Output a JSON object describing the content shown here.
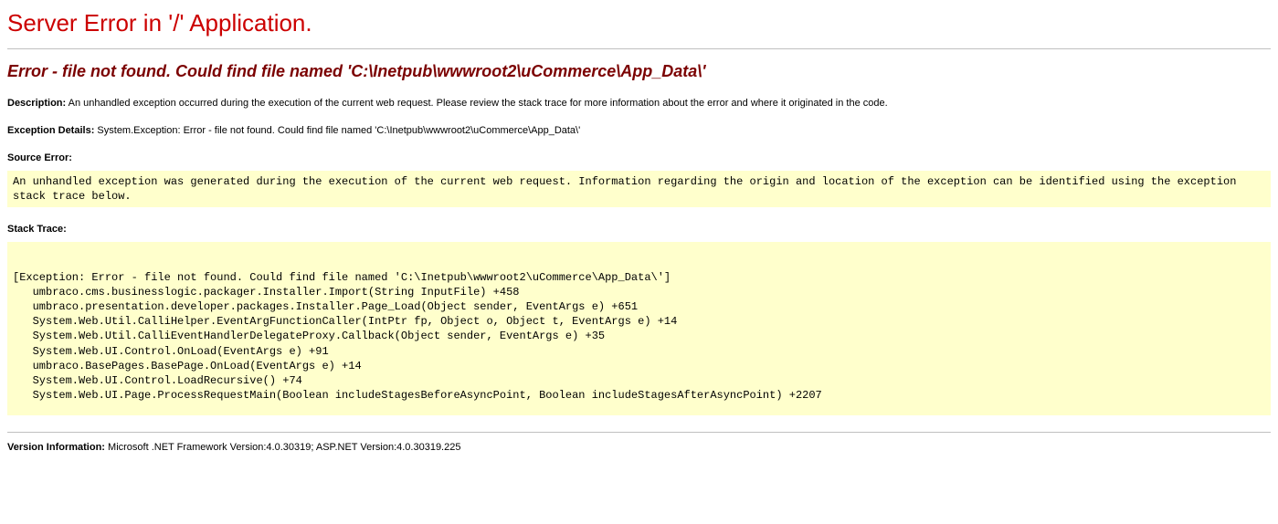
{
  "title": "Server Error in '/' Application.",
  "subtitle": "Error - file not found. Could find file named 'C:\\Inetpub\\wwwroot2\\uCommerce\\App_Data\\'",
  "description_label": "Description:",
  "description_text": "An unhandled exception occurred during the execution of the current web request. Please review the stack trace for more information about the error and where it originated in the code.",
  "exception_label": "Exception Details:",
  "exception_text": "System.Exception: Error - file not found. Could find file named 'C:\\Inetpub\\wwwroot2\\uCommerce\\App_Data\\'",
  "source_error_label": "Source Error:",
  "source_error_text": "An unhandled exception was generated during the execution of the current web request. Information regarding the origin and location of the exception can be identified using the exception stack trace below.",
  "stack_trace_label": "Stack Trace:",
  "stack_trace_text": "\n[Exception: Error - file not found. Could find file named 'C:\\Inetpub\\wwwroot2\\uCommerce\\App_Data\\']\n   umbraco.cms.businesslogic.packager.Installer.Import(String InputFile) +458\n   umbraco.presentation.developer.packages.Installer.Page_Load(Object sender, EventArgs e) +651\n   System.Web.Util.CalliHelper.EventArgFunctionCaller(IntPtr fp, Object o, Object t, EventArgs e) +14\n   System.Web.Util.CalliEventHandlerDelegateProxy.Callback(Object sender, EventArgs e) +35\n   System.Web.UI.Control.OnLoad(EventArgs e) +91\n   umbraco.BasePages.BasePage.OnLoad(EventArgs e) +14\n   System.Web.UI.Control.LoadRecursive() +74\n   System.Web.UI.Page.ProcessRequestMain(Boolean includeStagesBeforeAsyncPoint, Boolean includeStagesAfterAsyncPoint) +2207\n",
  "version_label": "Version Information:",
  "version_text": "Microsoft .NET Framework Version:4.0.30319; ASP.NET Version:4.0.30319.225"
}
